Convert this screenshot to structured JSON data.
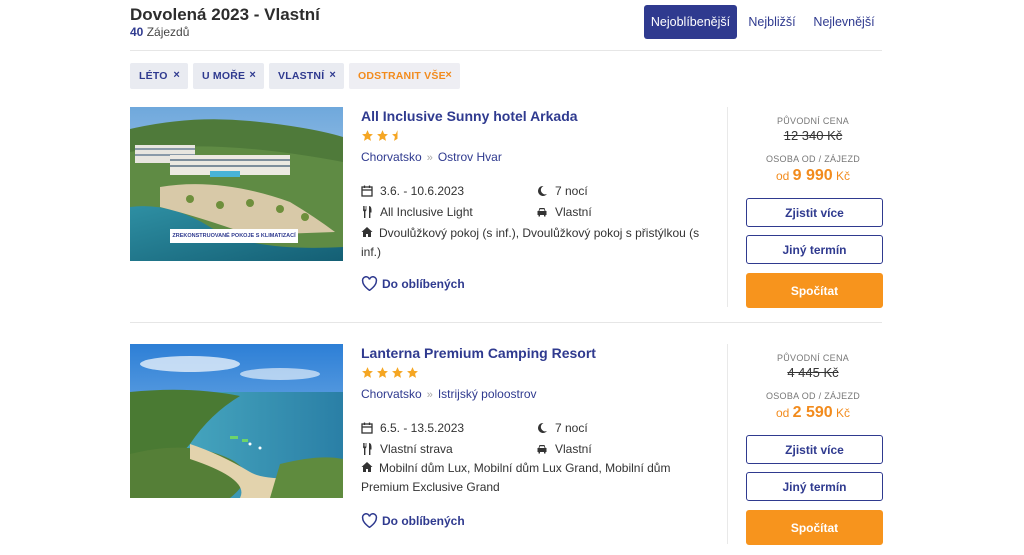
{
  "header": {
    "title": "Dovolená 2023 - Vlastní",
    "count": "40",
    "count_label": " Zájezdů"
  },
  "sort": {
    "favorite": "Nejoblíbenější",
    "nearest": "Nejbližší",
    "cheapest": "Nejlevnější",
    "active": "favorite"
  },
  "filters": [
    {
      "label": "LÉTO"
    },
    {
      "label": "U MOŘE"
    },
    {
      "label": "VLASTNÍ"
    },
    {
      "label": "ODSTRANIT VŠE"
    }
  ],
  "filter_remove_icon": "×",
  "results": [
    {
      "name": "All Inclusive Sunny hotel Arkada",
      "stars": 2.5,
      "country": "Chorvatsko",
      "region": "Ostrov Hvar",
      "dates": "3.6. - 10.6.2023",
      "nights": "7 nocí",
      "board": "All Inclusive Light",
      "transport": "Vlastní",
      "rooms": "Dvoulůžkový pokoj (s inf.), Dvoulůžkový pokoj s přistýlkou (s inf.)",
      "photo_caption": "ZREKONSTRUOVANÉ POKOJE S KLIMATIZACÍ",
      "favorite_label": "Do oblíbených",
      "original_price_label": "PŮVODNÍ CENA",
      "original_price": "12 340 Kč",
      "per_person_label": "OSOBA OD / ZÁJEZD",
      "price_prefix": "od",
      "price": "9 990",
      "currency": "Kč",
      "btn_more": "Zjistit více",
      "btn_other_date": "Jiný termín",
      "btn_calc": "Spočítat"
    },
    {
      "name": "Lanterna Premium Camping Resort",
      "stars": 4,
      "country": "Chorvatsko",
      "region": "Istrijský poloostrov",
      "dates": "6.5. - 13.5.2023",
      "nights": "7 nocí",
      "board": "Vlastní strava",
      "transport": "Vlastní",
      "rooms": "Mobilní dům Lux, Mobilní dům Lux Grand, Mobilní dům Premium Exclusive Grand",
      "favorite_label": "Do oblíbených",
      "original_price_label": "PŮVODNÍ CENA",
      "original_price": "4 445 Kč",
      "per_person_label": "OSOBA OD / ZÁJEZD",
      "price_prefix": "od",
      "price": "2 590",
      "currency": "Kč",
      "btn_more": "Zjistit více",
      "btn_other_date": "Jiný termín",
      "btn_calc": "Spočítat"
    }
  ],
  "icons": {
    "calendar": "calendar-icon",
    "moon": "moon-icon",
    "cutlery": "cutlery-icon",
    "car": "car-icon",
    "home": "home-icon",
    "heart": "heart-icon",
    "star": "star-icon"
  },
  "colors": {
    "brand": "#2f3a8f",
    "accent": "#f7941d",
    "star": "#f5a623"
  }
}
